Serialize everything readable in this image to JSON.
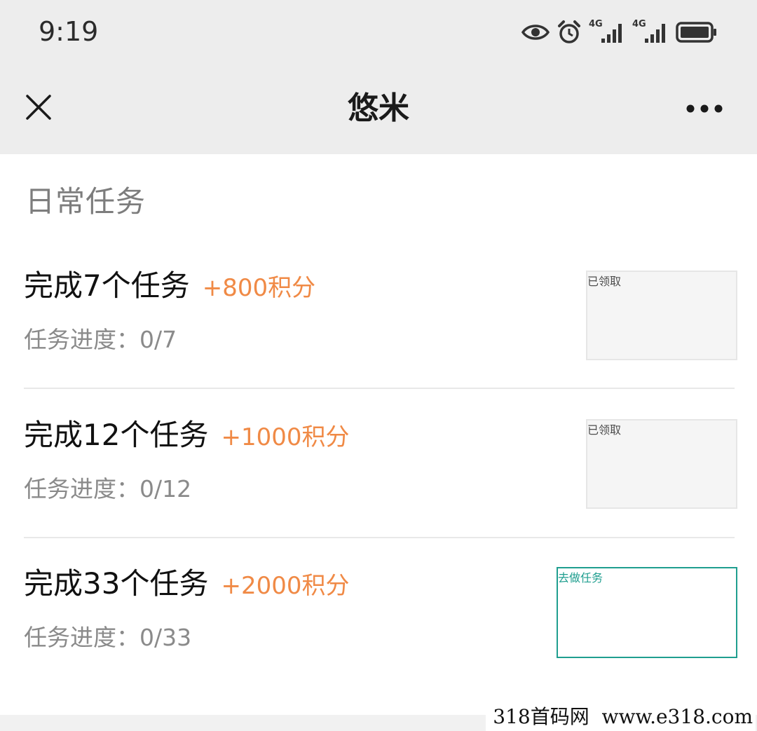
{
  "status_bar": {
    "time": "9:19",
    "icons": [
      "eye-icon",
      "alarm-icon",
      "signal-4g-icon",
      "signal-4g-icon",
      "battery-icon"
    ],
    "network_label_1": "4G",
    "network_label_2": "4G"
  },
  "nav": {
    "title": "悠米",
    "close_icon": "close-icon",
    "more_icon": "more-icon"
  },
  "section": {
    "title": "日常任务"
  },
  "tasks": [
    {
      "name": "完成7个任务",
      "points": "+800积分",
      "progress": "任务进度：0/7",
      "button": "已领取"
    },
    {
      "name": "完成12个任务",
      "points": "+1000积分",
      "progress": "任务进度：0/12",
      "button": "已领取"
    },
    {
      "name": "完成33个任务",
      "points": "+2000积分",
      "progress": "任务进度：0/33",
      "button": "去做任务"
    }
  ],
  "colors": {
    "accent": "#1f9e8f",
    "points": "#f08a46",
    "header_bg": "#ededed"
  },
  "watermark": "318首码网  www.e318.com"
}
